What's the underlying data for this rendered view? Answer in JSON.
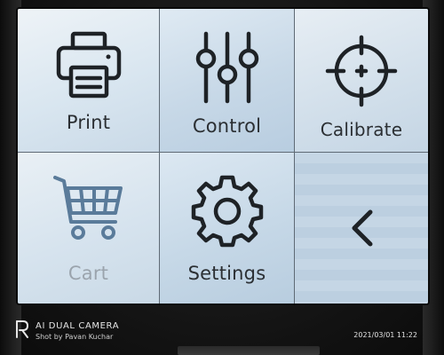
{
  "menu": {
    "tiles": [
      {
        "label": "Print",
        "icon": "printer-icon"
      },
      {
        "label": "Control",
        "icon": "sliders-icon"
      },
      {
        "label": "Calibrate",
        "icon": "crosshair-icon"
      },
      {
        "label": "Cart",
        "icon": "cart-icon"
      },
      {
        "label": "Settings",
        "icon": "gear-icon"
      },
      {
        "label": "",
        "icon": "back-arrow-icon"
      }
    ]
  },
  "watermark": {
    "camera": "AI DUAL CAMERA",
    "shot_by": "Shot by Pavan Kuchar",
    "timestamp": "2021/03/01 11:22"
  },
  "colors": {
    "icon_stroke": "#1e2226",
    "label_text": "#2b2f33",
    "disabled_text": "#9ba4ad"
  }
}
